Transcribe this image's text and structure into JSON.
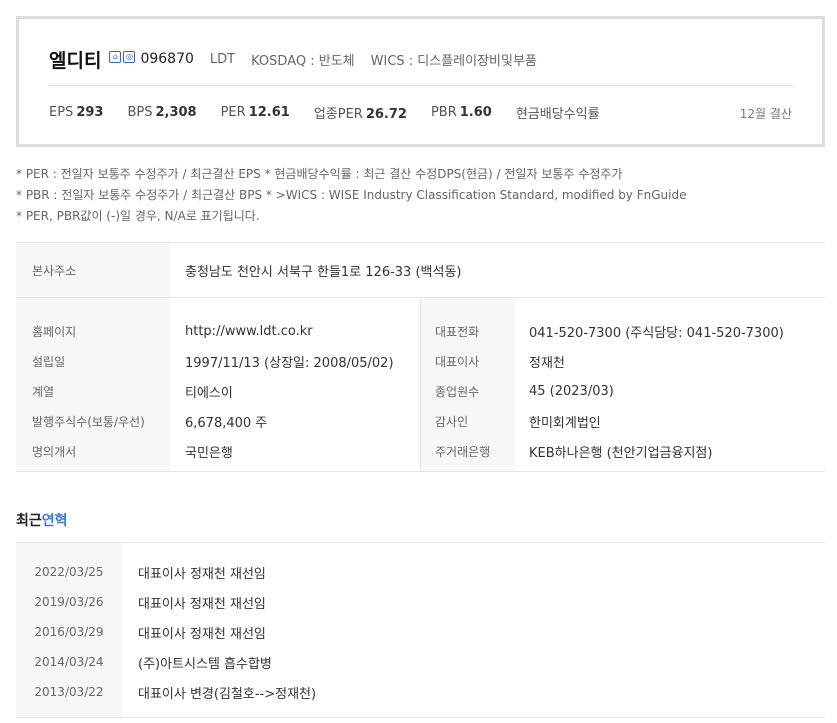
{
  "company": {
    "name": "엘디티",
    "code": "096870",
    "ticker": "LDT",
    "market": "KOSDAQ : 반도체",
    "wics": "WICS : 디스플레이장비및부품"
  },
  "metrics": [
    {
      "label": "EPS",
      "value": "293"
    },
    {
      "label": "BPS",
      "value": "2,308"
    },
    {
      "label": "PER",
      "value": "12.61"
    },
    {
      "label": "업종PER",
      "value": "26.72"
    },
    {
      "label": "PBR",
      "value": "1.60"
    },
    {
      "label": "현금배당수익률",
      "value": ""
    }
  ],
  "settlement": "12월 결산",
  "notes": [
    "* PER : 전일자 보통주 수정주가 / 최근결산 EPS * 현금배당수익률 : 최근 결산 수정DPS(현금) / 전일자 보통주 수정주가",
    "* PBR : 전일자 보통주 수정주가 / 최근결산 BPS * >WICS : WISE Industry Classification Standard, modified by FnGuide",
    "* PER, PBR값이 (-)일 경우, N/A로 표기됩니다."
  ],
  "address": {
    "label": "본사주소",
    "value": "충청남도 천안시 서북구 한들1로 126-33 (백석동)"
  },
  "info_left": [
    {
      "label": "홈페이지",
      "value": "http://www.ldt.co.kr"
    },
    {
      "label": "설립일",
      "value": "1997/11/13 (상장일: 2008/05/02)"
    },
    {
      "label": "계열",
      "value": "티에스이"
    },
    {
      "label": "발행주식수(보통/우선)",
      "value": "6,678,400 주"
    },
    {
      "label": "명의개서",
      "value": "국민은행"
    }
  ],
  "info_right": [
    {
      "label": "대표전화",
      "value": "041-520-7300 (주식담당: 041-520-7300)"
    },
    {
      "label": "대표이사",
      "value": "정재천"
    },
    {
      "label": "종업원수",
      "value": "45 (2023/03)"
    },
    {
      "label": "감사인",
      "value": "한미회계법인"
    },
    {
      "label": "주거래은행",
      "value": "KEB하나은행 (천안기업금융지점)"
    }
  ],
  "history_title": {
    "part1": "최근",
    "part2": "연혁"
  },
  "history": [
    {
      "date": "2022/03/25",
      "event": "대표이사 정재천 재선임"
    },
    {
      "date": "2019/03/26",
      "event": "대표이사 정재천 재선임"
    },
    {
      "date": "2016/03/29",
      "event": "대표이사 정재천 재선임"
    },
    {
      "date": "2014/03/24",
      "event": "(주)아트시스템 흡수합병"
    },
    {
      "date": "2013/03/22",
      "event": "대표이사 변경(김철호-->정재천)"
    }
  ],
  "colors": {
    "accent": "#3b7bd6",
    "label_bg": "#f7f7f7",
    "border": "#dcdcdc"
  }
}
